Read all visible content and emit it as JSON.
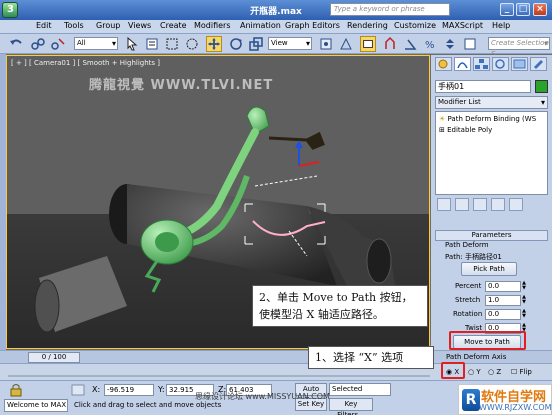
{
  "window": {
    "title": "开瓶器.max",
    "min": "_",
    "max": "□",
    "close": "×"
  },
  "menu": {
    "items": [
      "Edit",
      "Tools",
      "Group",
      "Views",
      "Create",
      "Modifiers",
      "Animation",
      "Graph Editors",
      "Rendering",
      "Customize",
      "MAXScript",
      "Help"
    ],
    "search_placeholder": "Type a keyword or phrase"
  },
  "toolbar": {
    "filter_value": "All",
    "refcoord_value": "View",
    "named_sel_placeholder": "Create Selection S"
  },
  "viewport": {
    "label": "[ + ] [ Camera01 ] [ Smooth + Highlights ]",
    "watermark": "腾龍視覺 WWW.TLVI.NET"
  },
  "command_panel": {
    "object_name": "手柄01",
    "object_color": "#29a329",
    "modifier_list": "Modifier List",
    "stack": [
      "Path Deform Binding (WS",
      "Editable Poly"
    ],
    "rollout_title": "Parameters",
    "path_deform_title": "Path Deform",
    "path_label": "Path: 手柄路径01",
    "pick_path": "Pick Path",
    "params": [
      {
        "label": "Percent",
        "value": "0.0"
      },
      {
        "label": "Stretch",
        "value": "1.0"
      },
      {
        "label": "Rotation",
        "value": "0.0"
      },
      {
        "label": "Twist",
        "value": "0.0"
      }
    ],
    "move_to_path": "Move to Path",
    "axis_title": "Path Deform Axis",
    "axes": [
      "X",
      "Y",
      "Z"
    ],
    "flip": "Flip"
  },
  "timeline": {
    "slider": "0 / 100"
  },
  "status": {
    "x_label": "X:",
    "x_value": "-96.519",
    "y_label": "Y:",
    "y_value": "32.915",
    "z_label": "Z:",
    "z_value": "61.403",
    "maxscript": "Welcome to MAX",
    "prompt": "Click and drag to select and move objects",
    "auto_key": "Auto Key",
    "selected": "Selected",
    "set_key": "Set Key",
    "key_filters": "Key Filters..."
  },
  "annotations": {
    "callout_move": "2、单击 Move to Path 按钮，使模型沿 X 轴适应路径。",
    "callout_axis": "1、选择 “X” 选项"
  },
  "watermarks": {
    "bottom": "思缘设计论坛 www.MISSYUAN.COM",
    "logo_main": "软件自学网",
    "logo_sub": "WWW.RJZXW.COM",
    "logo_mark": "R"
  }
}
